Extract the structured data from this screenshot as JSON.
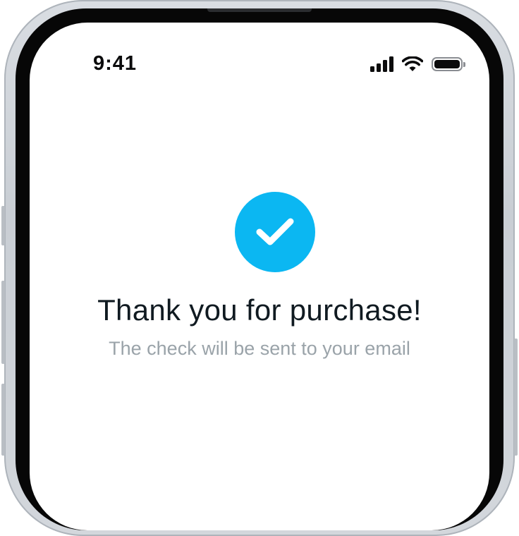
{
  "status_bar": {
    "time": "9:41",
    "icons": [
      "cellular-signal-icon",
      "wifi-icon",
      "battery-icon"
    ]
  },
  "confirmation": {
    "icon": "checkmark-icon",
    "accent_color": "#0bb7f2",
    "title": "Thank you for purchase!",
    "subtitle": "The check will be sent to your email"
  }
}
